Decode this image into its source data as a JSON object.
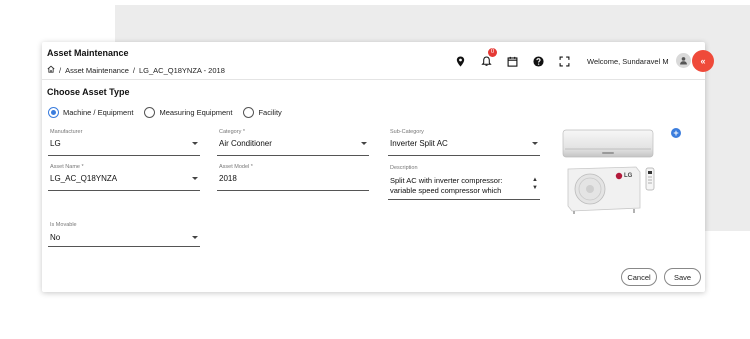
{
  "header": {
    "title": "Asset Maintenance",
    "breadcrumb": [
      "Asset Maintenance",
      "LG_AC_Q18YNZA - 2018"
    ],
    "breadcrumb_separator": "/",
    "notification_count": "0",
    "welcome_text": "Welcome, Sundaravel M",
    "icons": [
      "home-icon",
      "location-pin-icon",
      "bell-icon",
      "calendar-icon",
      "help-icon",
      "fullscreen-icon",
      "user-icon",
      "collapse-chevrons-icon"
    ],
    "fab_glyph": "«"
  },
  "form": {
    "section_title": "Choose Asset Type",
    "asset_types": [
      {
        "label": "Machine / Equipment",
        "selected": true
      },
      {
        "label": "Measuring Equipment",
        "selected": false
      },
      {
        "label": "Facility",
        "selected": false
      }
    ],
    "manufacturer": {
      "label": "Manufacturer",
      "value": "LG"
    },
    "category": {
      "label": "Category *",
      "value": "Air Conditioner"
    },
    "sub_category": {
      "label": "Sub-Category",
      "value": "Inverter Split AC"
    },
    "asset_name": {
      "label": "Asset Name *",
      "value": "LG_AC_Q18YNZA"
    },
    "asset_model": {
      "label": "Asset Model *",
      "value": "2018"
    },
    "description": {
      "label": "Description",
      "line1": "Split AC with inverter compressor:",
      "line2": "variable speed compressor which"
    },
    "is_movable": {
      "label": "Is Movable",
      "value": "No"
    },
    "image_badge_text": "LG",
    "add_icon": "+"
  },
  "actions": {
    "cancel_label": "Cancel",
    "save_label": "Save"
  },
  "colors": {
    "accent": "#3b7ddd",
    "fab": "#ef4a3a",
    "badge": "#e53935"
  }
}
